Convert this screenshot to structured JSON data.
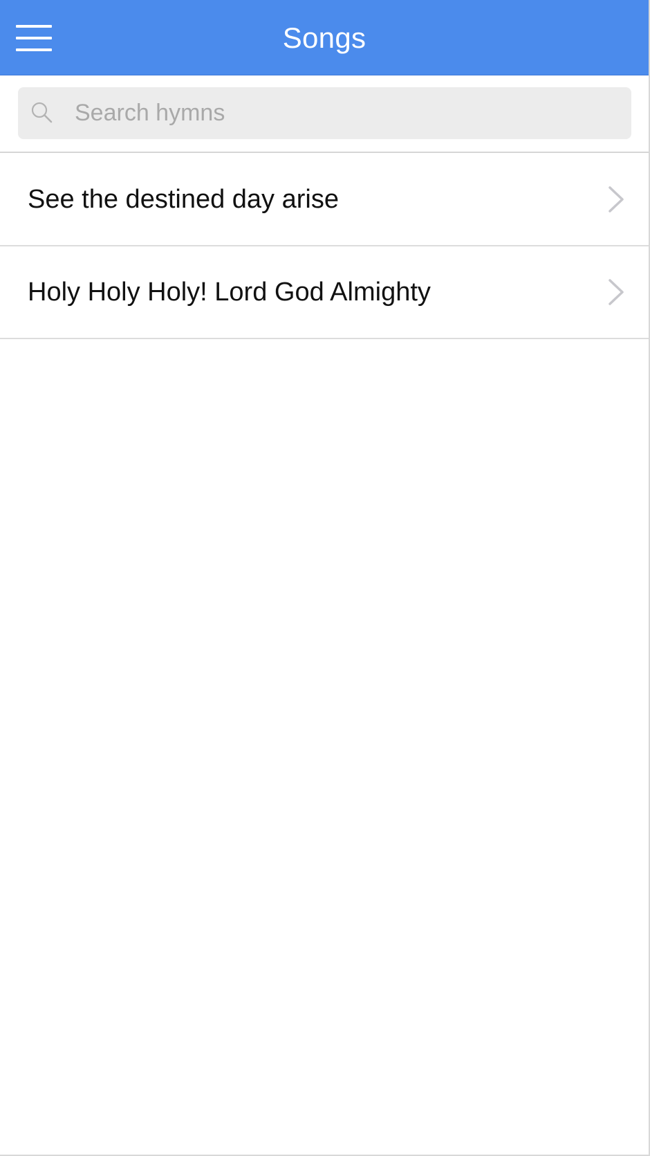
{
  "header": {
    "title": "Songs",
    "menu_icon": "hamburger-menu-icon",
    "background_color": "#4b8bec"
  },
  "search": {
    "placeholder": "Search hymns",
    "value": "",
    "icon": "search-icon"
  },
  "songs": {
    "items": [
      {
        "label": "See the destined day arise",
        "icon": "chevron-right-icon"
      },
      {
        "label": "Holy Holy Holy! Lord God Almighty",
        "icon": "chevron-right-icon"
      }
    ]
  }
}
